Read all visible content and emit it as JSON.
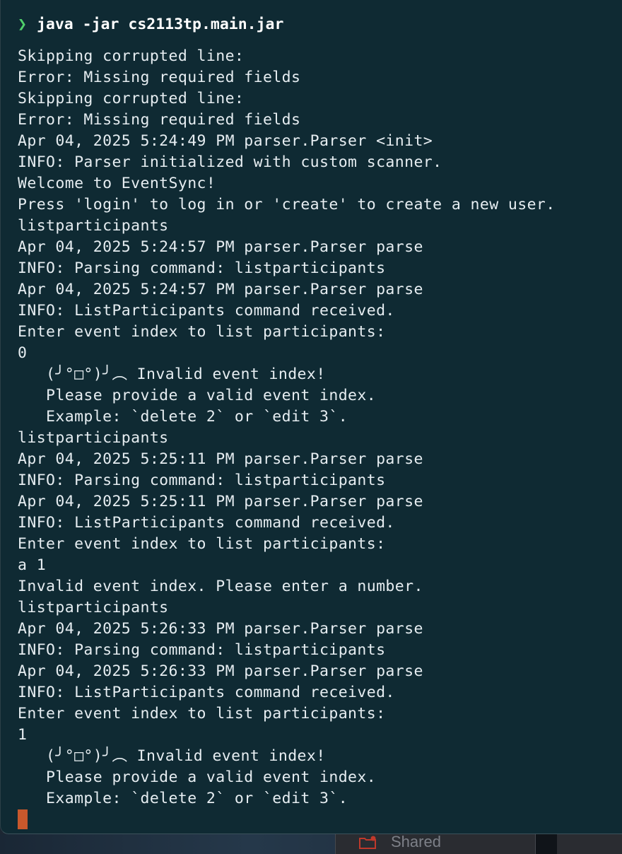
{
  "terminal": {
    "prompt_symbol": "❯",
    "command": "java -jar cs2113tp.main.jar",
    "lines": [
      "Skipping corrupted line:",
      "Error: Missing required fields",
      "Skipping corrupted line:",
      "Error: Missing required fields",
      "Apr 04, 2025 5:24:49 PM parser.Parser <init>",
      "INFO: Parser initialized with custom scanner.",
      "Welcome to EventSync!",
      "Press 'login' to log in or 'create' to create a new user.",
      "listparticipants",
      "Apr 04, 2025 5:24:57 PM parser.Parser parse",
      "INFO: Parsing command: listparticipants",
      "Apr 04, 2025 5:24:57 PM parser.Parser parse",
      "INFO: ListParticipants command received.",
      "Enter event index to list participants:",
      "0",
      "   (╯°□°)╯︵ Invalid event index!",
      "   Please provide a valid event index.",
      "   Example: `delete 2` or `edit 3`.",
      "listparticipants",
      "Apr 04, 2025 5:25:11 PM parser.Parser parse",
      "INFO: Parsing command: listparticipants",
      "Apr 04, 2025 5:25:11 PM parser.Parser parse",
      "INFO: ListParticipants command received.",
      "Enter event index to list participants:",
      "a 1",
      "Invalid event index. Please enter a number.",
      "listparticipants",
      "Apr 04, 2025 5:26:33 PM parser.Parser parse",
      "INFO: Parsing command: listparticipants",
      "Apr 04, 2025 5:26:33 PM parser.Parser parse",
      "INFO: ListParticipants command received.",
      "Enter event index to list participants:",
      "1",
      "   (╯°□°)╯︵ Invalid event index!",
      "   Please provide a valid event index.",
      "   Example: `delete 2` or `edit 3`."
    ]
  },
  "background_window": {
    "tab_label": "Shared",
    "icon": "folder-icon"
  },
  "colors": {
    "terminal_bg": "#0f2a33",
    "text": "#e6edf1",
    "prompt_chevron": "#4fd06b",
    "cursor": "#c8582c"
  }
}
